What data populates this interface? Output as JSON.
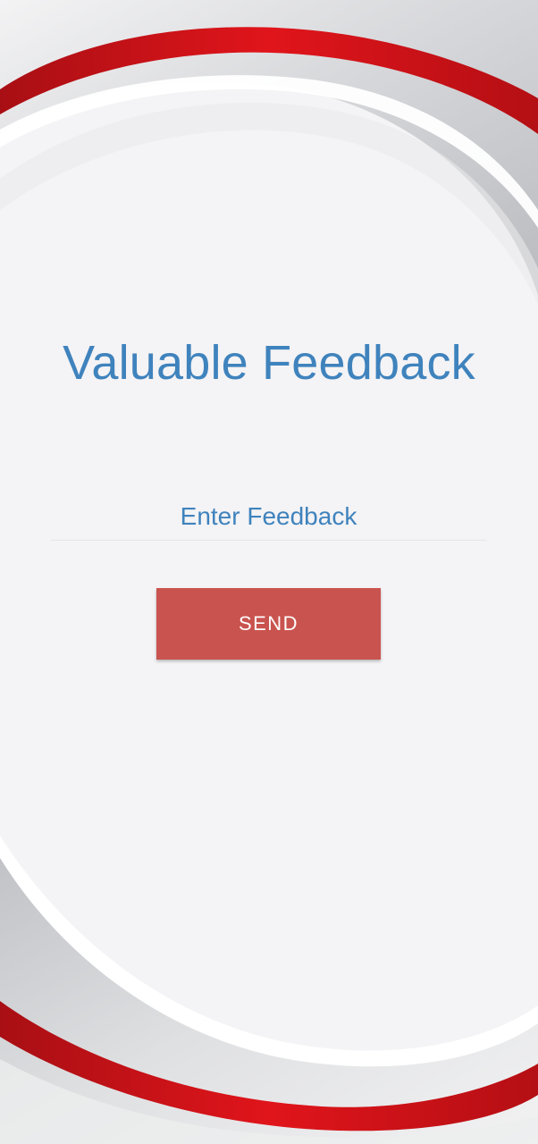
{
  "screen": {
    "title": "Valuable Feedback",
    "feedback_input": {
      "placeholder": "Enter Feedback",
      "value": ""
    },
    "send_label": "SEND"
  },
  "theme": {
    "accent_blue": "#3f83bd",
    "button_red": "#c9534e",
    "swoosh_red": "#d71a1f",
    "background": "#f4f3f5"
  }
}
